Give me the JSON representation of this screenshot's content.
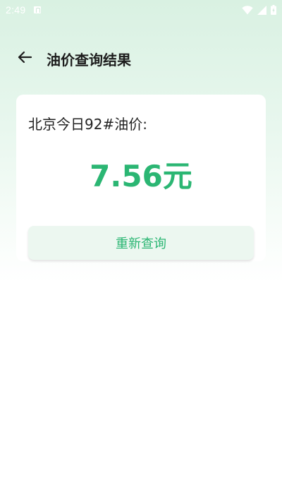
{
  "status_bar": {
    "time": "2:49",
    "icons": [
      "a-notification-icon",
      "wifi-icon",
      "signal-icon",
      "battery-icon"
    ]
  },
  "app_bar": {
    "back_icon": "arrow-left-icon",
    "title": "油价查询结果"
  },
  "result": {
    "label": "北京今日92#油价:",
    "value": "7.56元",
    "requery_label": "重新查询"
  },
  "colors": {
    "accent": "#2bb673",
    "button_bg": "#ecf7f0",
    "header_gradient_top": "#d9f1e2",
    "text_primary": "#1d1d1d"
  }
}
